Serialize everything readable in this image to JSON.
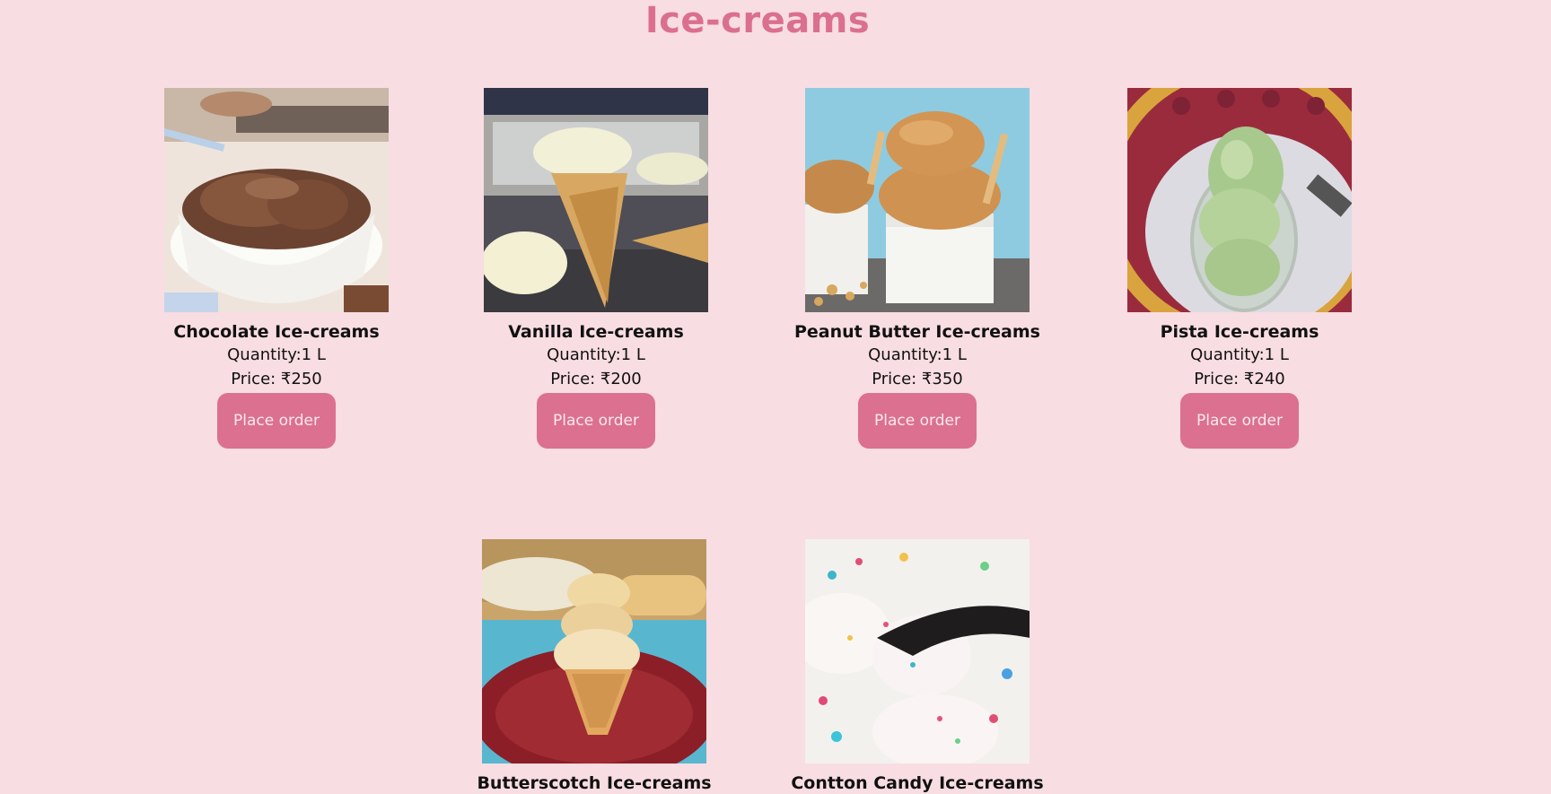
{
  "header": {
    "title": "Ice-creams"
  },
  "theme": {
    "background": "#f8dde2",
    "accent": "#db6f8f",
    "button_bg": "#dc7090",
    "button_text": "#fbe9ee"
  },
  "products": [
    {
      "name": "Chocolate Ice-creams",
      "quantity": "Quantity:1 L",
      "price": "Price: ₹250",
      "button_label": "Place order"
    },
    {
      "name": "Vanilla Ice-creams",
      "quantity": "Quantity:1 L",
      "price": "Price: ₹200",
      "button_label": "Place order"
    },
    {
      "name": "Peanut Butter Ice-creams",
      "quantity": "Quantity:1 L",
      "price": "Price: ₹350",
      "button_label": "Place order"
    },
    {
      "name": "Pista Ice-creams",
      "quantity": "Quantity:1 L",
      "price": "Price: ₹240",
      "button_label": "Place order"
    },
    {
      "name": "Butterscotch Ice-creams"
    },
    {
      "name": "Contton Candy Ice-creams"
    }
  ]
}
